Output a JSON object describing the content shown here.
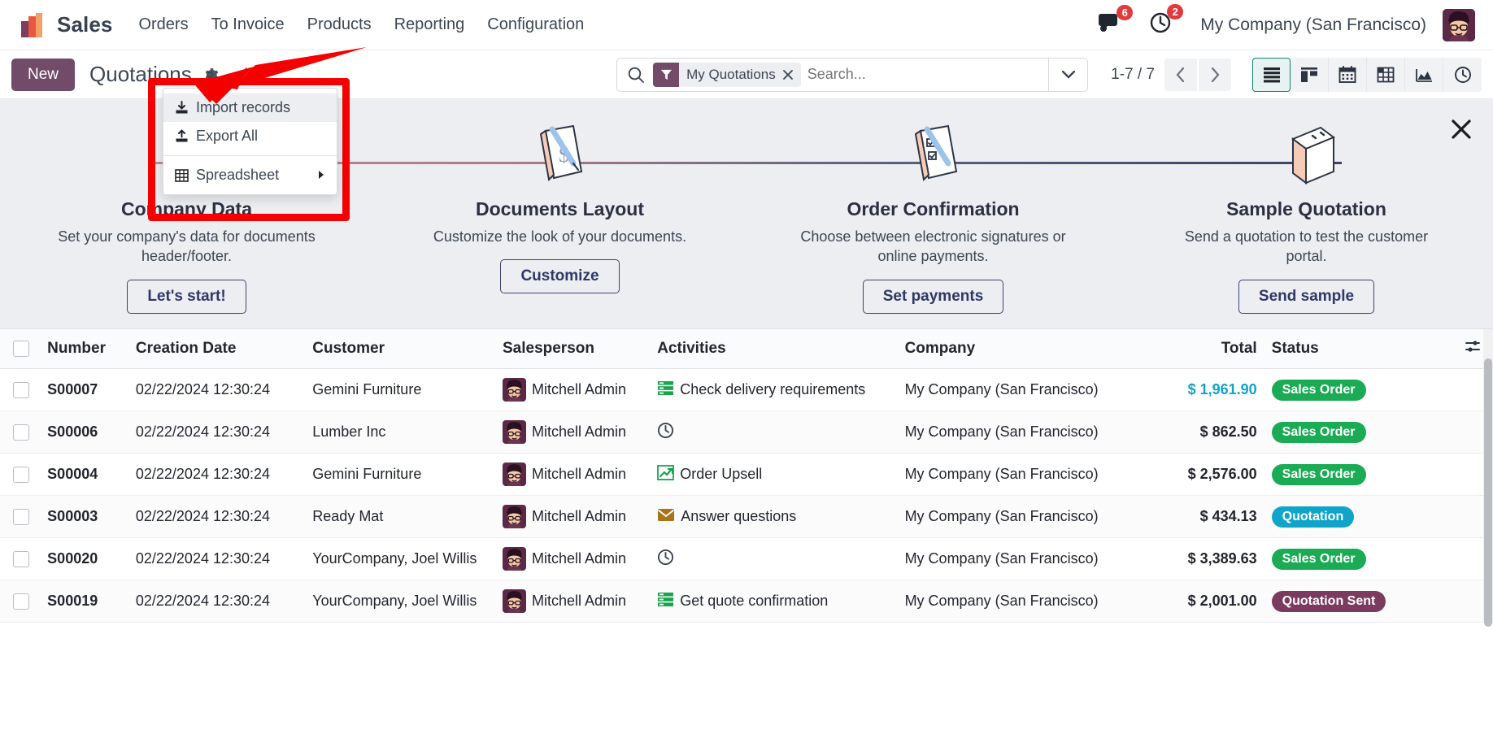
{
  "navbar": {
    "logo_icon": "odoo-sales-logo-icon",
    "app_name": "Sales",
    "menu_items": [
      {
        "label": "Orders",
        "name": "nav-item-orders"
      },
      {
        "label": "To Invoice",
        "name": "nav-item-to-invoice"
      },
      {
        "label": "Products",
        "name": "nav-item-products"
      },
      {
        "label": "Reporting",
        "name": "nav-item-reporting"
      },
      {
        "label": "Configuration",
        "name": "nav-item-configuration"
      }
    ],
    "messages_icon": "messages-bubble-icon",
    "messages_count": "6",
    "activities_icon": "activities-clock-icon",
    "activities_count": "2",
    "company": "My Company (San Francisco)",
    "avatar_icon": "user-avatar"
  },
  "control_panel": {
    "new_label": "New",
    "title": "Quotations",
    "cog_icon": "gear-icon",
    "search": {
      "search_icon": "search-icon",
      "facet_icon": "filter-icon",
      "facet_label": "My Quotations",
      "facet_remove_icon": "close-icon",
      "placeholder": "Search...",
      "toggle_icon": "chevron-down-icon"
    },
    "pager": {
      "range": "1-7 / 7",
      "prev_icon": "chevron-left-icon",
      "next_icon": "chevron-right-icon"
    },
    "views": [
      {
        "name": "view-list",
        "icon": "list-icon",
        "active": true
      },
      {
        "name": "view-kanban",
        "icon": "kanban-icon",
        "active": false
      },
      {
        "name": "view-calendar",
        "icon": "calendar-icon",
        "active": false
      },
      {
        "name": "view-pivot",
        "icon": "pivot-table-icon",
        "active": false
      },
      {
        "name": "view-graph",
        "icon": "graph-icon",
        "active": false
      },
      {
        "name": "view-activity",
        "icon": "clock-icon",
        "active": false
      }
    ]
  },
  "dropdown": {
    "items": [
      {
        "label": "Import records",
        "icon": "import-download-icon",
        "highlighted": true
      },
      {
        "label": "Export All",
        "icon": "export-upload-icon",
        "highlighted": false
      },
      {
        "label": "Spreadsheet",
        "icon": "spreadsheet-grid-icon",
        "highlighted": false,
        "has_submenu": true
      }
    ]
  },
  "onboarding": {
    "close_icon": "close-icon",
    "cards": [
      {
        "icon": "company-data-book-icon",
        "title": "Company Data",
        "desc": "Set your company's data for documents header/footer.",
        "button": "Let's start!"
      },
      {
        "icon": "documents-layout-icon",
        "title": "Documents Layout",
        "desc": "Customize the look of your documents.",
        "button": "Customize"
      },
      {
        "icon": "order-confirmation-icon",
        "title": "Order Confirmation",
        "desc": "Choose between electronic signatures or online payments.",
        "button": "Set payments"
      },
      {
        "icon": "sample-quotation-icon",
        "title": "Sample Quotation",
        "desc": "Send a quotation to test the customer portal.",
        "button": "Send sample"
      }
    ]
  },
  "table": {
    "columns": [
      "Number",
      "Creation Date",
      "Customer",
      "Salesperson",
      "Activities",
      "Company",
      "Total",
      "Status"
    ],
    "options_icon": "column-options-icon",
    "rows": [
      {
        "number": "S00007",
        "date": "02/22/2024 12:30:24",
        "customer": "Gemini Furniture",
        "salesperson": "Mitchell Admin",
        "activity": "Check delivery requirements",
        "activity_icon": "todo-list-icon",
        "activity_color": "#18a54a",
        "company": "My Company (San Francisco)",
        "total": "$ 1,961.90",
        "total_is_link": true,
        "status": "Sales Order",
        "status_class": "b-green"
      },
      {
        "number": "S00006",
        "date": "02/22/2024 12:30:24",
        "customer": "Lumber Inc",
        "salesperson": "Mitchell Admin",
        "activity": "",
        "activity_icon": "clock-icon",
        "activity_color": "#3d4653",
        "company": "My Company (San Francisco)",
        "total": "$ 862.50",
        "total_is_link": false,
        "status": "Sales Order",
        "status_class": "b-green"
      },
      {
        "number": "S00004",
        "date": "02/22/2024 12:30:24",
        "customer": "Gemini Furniture",
        "salesperson": "Mitchell Admin",
        "activity": "Order Upsell",
        "activity_icon": "trend-up-icon",
        "activity_color": "#18a54a",
        "company": "My Company (San Francisco)",
        "total": "$ 2,576.00",
        "total_is_link": false,
        "status": "Sales Order",
        "status_class": "b-green"
      },
      {
        "number": "S00003",
        "date": "02/22/2024 12:30:24",
        "customer": "Ready Mat",
        "salesperson": "Mitchell Admin",
        "activity": "Answer questions",
        "activity_icon": "envelope-icon",
        "activity_color": "#a8741a",
        "company": "My Company (San Francisco)",
        "total": "$ 434.13",
        "total_is_link": false,
        "status": "Quotation",
        "status_class": "b-cyan"
      },
      {
        "number": "S00020",
        "date": "02/22/2024 12:30:24",
        "customer": "YourCompany, Joel Willis",
        "salesperson": "Mitchell Admin",
        "activity": "",
        "activity_icon": "clock-icon",
        "activity_color": "#3d4653",
        "company": "My Company (San Francisco)",
        "total": "$ 3,389.63",
        "total_is_link": false,
        "status": "Sales Order",
        "status_class": "b-green"
      },
      {
        "number": "S00019",
        "date": "02/22/2024 12:30:24",
        "customer": "YourCompany, Joel Willis",
        "salesperson": "Mitchell Admin",
        "activity": "Get quote confirmation",
        "activity_icon": "todo-list-icon",
        "activity_color": "#18a54a",
        "company": "My Company (San Francisco)",
        "total": "$ 2,001.00",
        "total_is_link": false,
        "status": "Quotation Sent",
        "status_class": "b-plum"
      }
    ]
  },
  "colors": {
    "brand_purple": "#714b67",
    "status_green": "#1aab54",
    "status_cyan": "#11a4c9",
    "status_plum": "#7b3b5e",
    "annotation_red": "#f40000",
    "badge_red": "#e03a3c"
  }
}
